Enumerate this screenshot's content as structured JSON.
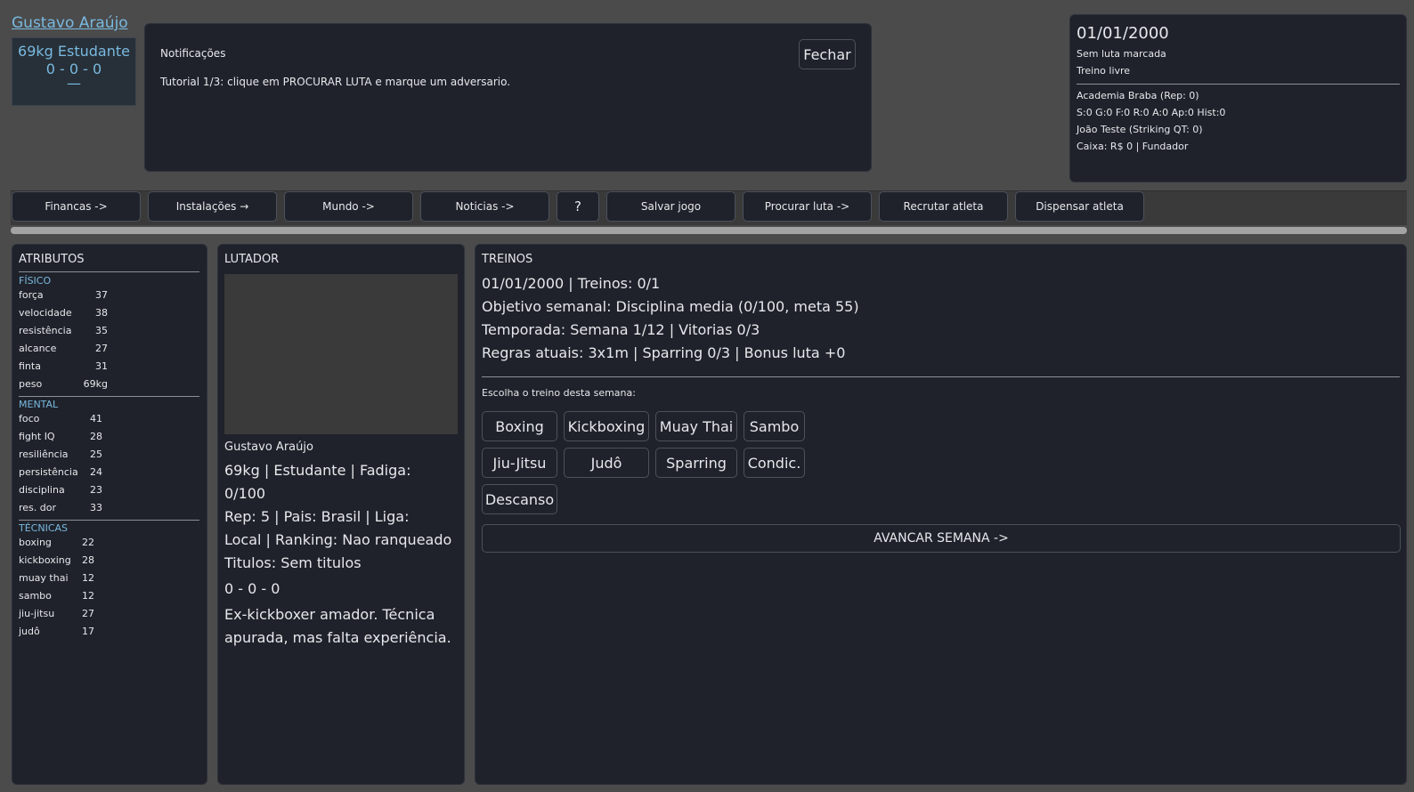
{
  "player": {
    "name": "Gustavo Araújo",
    "card_line1": "69kg  Estudante",
    "card_line2": "0 - 0 - 0",
    "card_line3": "—"
  },
  "notifications": {
    "title": "Notificações",
    "text": "Tutorial 1/3: clique em PROCURAR LUTA e marque um adversario.",
    "close_label": "Fechar"
  },
  "info": {
    "date": "01/01/2000",
    "fight_status": "Sem luta marcada",
    "training": "Treino livre",
    "academy": "Academia Braba  (Rep: 0)",
    "stats": "S:0 G:0 F:0 R:0 A:0 Ap:0  Hist:0",
    "coach": "João Teste  (Striking  QT: 0)",
    "cash": "Caixa: R$ 0  |  Fundador"
  },
  "toolbar": {
    "financas": "Financas ->",
    "instalacoes": "Instalações →",
    "mundo": "Mundo ->",
    "noticias": "Noticias ->",
    "help": "?",
    "salvar": "Salvar jogo",
    "procurar": "Procurar luta ->",
    "recrutar": "Recrutar atleta",
    "dispensar": "Dispensar atleta"
  },
  "progress": {
    "fraction": 1.0
  },
  "attributes": {
    "title": "ATRIBUTOS",
    "fisico_label": "FÍSICO",
    "fisico": [
      {
        "name": "força",
        "value": "37"
      },
      {
        "name": "velocidade",
        "value": "38"
      },
      {
        "name": "resistência",
        "value": "35"
      },
      {
        "name": "alcance",
        "value": "27"
      },
      {
        "name": "finta",
        "value": "31"
      },
      {
        "name": "peso",
        "value": "69kg"
      }
    ],
    "mental_label": "MENTAL",
    "mental": [
      {
        "name": "foco",
        "value": "41"
      },
      {
        "name": "fight IQ",
        "value": "28"
      },
      {
        "name": "resiliência",
        "value": "25"
      },
      {
        "name": "persistência",
        "value": "24"
      },
      {
        "name": "disciplina",
        "value": "23"
      },
      {
        "name": "res. dor",
        "value": "33"
      }
    ],
    "tecnicas_label": "TÉCNICAS",
    "tecnicas": [
      {
        "name": "boxing",
        "value": "22"
      },
      {
        "name": "kickboxing",
        "value": "28"
      },
      {
        "name": "muay thai",
        "value": "12"
      },
      {
        "name": "sambo",
        "value": "12"
      },
      {
        "name": "jiu-jitsu",
        "value": "27"
      },
      {
        "name": "judô",
        "value": "17"
      }
    ]
  },
  "fighter": {
    "title": "LUTADOR",
    "name": "Gustavo Araújo",
    "line1": "69kg  |  Estudante  |  Fadiga:",
    "line2": "0/100",
    "line3": "Rep: 5  |  Pais: Brasil  |  Liga:",
    "line4": "Local  |  Ranking: Nao ranqueado",
    "line5": "Titulos: Sem titulos",
    "record": "0 - 0 - 0",
    "bio1": "Ex-kickboxer amador. Técnica",
    "bio2": "apurada, mas falta experiência."
  },
  "training": {
    "title": "TREINOS",
    "line1": "01/01/2000  |  Treinos: 0/1",
    "line2": "Objetivo semanal: Disciplina media (0/100, meta 55)",
    "line3": "Temporada: Semana 1/12 | Vitorias 0/3",
    "line4": "Regras atuais: 3x1m  |  Sparring 0/3  |  Bonus luta +0",
    "choose": "Escolha o treino desta semana:",
    "options": [
      "Boxing",
      "Kickboxing",
      "Muay Thai",
      "Sambo",
      "Jiu-Jitsu",
      "Judô",
      "Sparring",
      "Condic.",
      "Descanso"
    ],
    "advance": "AVANCAR SEMANA ->"
  }
}
